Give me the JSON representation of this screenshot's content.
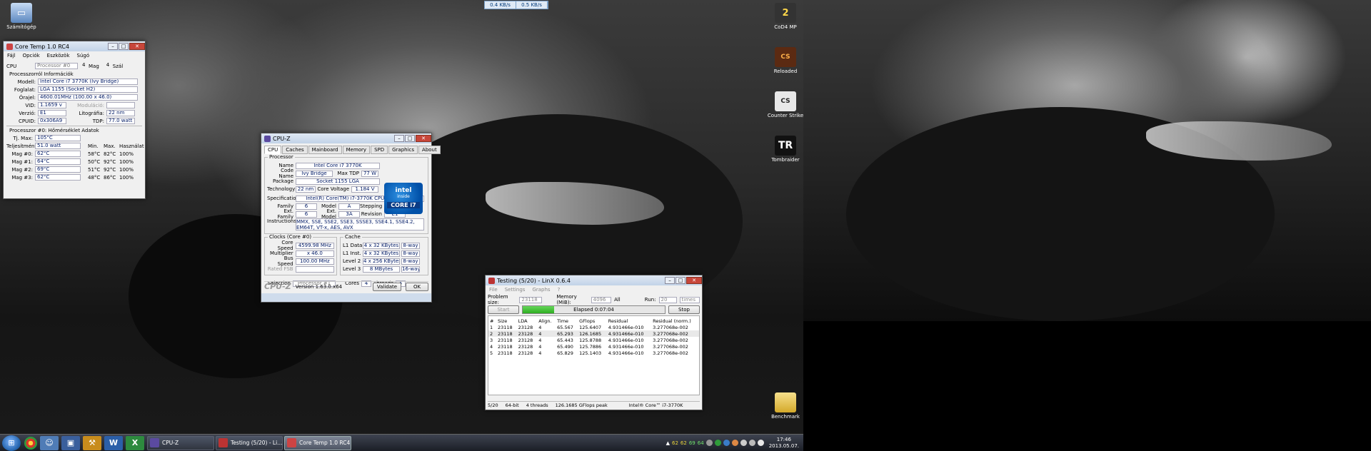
{
  "desktop": {
    "icons_left": [
      {
        "label": "Számítógép"
      }
    ],
    "icons_right": [
      {
        "label": "CoD4 MP",
        "badge": "2"
      },
      {
        "label": "Reloaded",
        "badge": "CS"
      },
      {
        "label": "Counter Strike",
        "badge": "CS"
      },
      {
        "label": "Tombraider",
        "badge": "TR"
      },
      {
        "label": "Benchmark",
        "badge": ""
      }
    ]
  },
  "netmeter": {
    "down": "0.4 KB/s",
    "up": "0.5 KB/s"
  },
  "coretemp": {
    "title": "Core Temp 1.0 RC4",
    "menu": [
      "Fájl",
      "Opciók",
      "Eszközök",
      "Súgó"
    ],
    "cpu_label": "CPU",
    "processor_select": "Processor #0",
    "cores": "4",
    "cores_label": "Mag",
    "threads": "4",
    "threads_label": "Szál",
    "info_section": "Processzorról Információk",
    "model_label": "Modell:",
    "model": "Intel Core i7 3770K (Ivy Bridge)",
    "socket_label": "Foglalat:",
    "socket": "LGA 1155 (Socket H2)",
    "freq_label": "Órajel:",
    "freq": "4600.01MHz (100.00 x 46.0)",
    "vid_label": "VID:",
    "vid": "1.1659 v",
    "modulation_label": "Moduláció:",
    "revision_label": "Verzió:",
    "revision": "E1",
    "litho_label": "Litográfia:",
    "litho": "22 nm",
    "cpuid_label": "CPUID:",
    "cpuid": "0x306A9",
    "tdp_label": "TDP:",
    "tdp": "77.0 watt",
    "temp_section": "Processzor #0: Hőmérséklet Adatok",
    "tjmax_label": "Tj. Max:",
    "tjmax": "105°C",
    "power_label": "Teljesítmény:",
    "power": "51.0 watt",
    "col_min": "Min.",
    "col_max": "Max.",
    "col_load": "Használat",
    "cores_rows": [
      {
        "label": "Mag #0:",
        "temp": "62°C",
        "min": "58°C",
        "max": "82°C",
        "load": "100%"
      },
      {
        "label": "Mag #1:",
        "temp": "64°C",
        "min": "50°C",
        "max": "92°C",
        "load": "100%"
      },
      {
        "label": "Mag #2:",
        "temp": "69°C",
        "min": "51°C",
        "max": "92°C",
        "load": "100%"
      },
      {
        "label": "Mag #3:",
        "temp": "62°C",
        "min": "48°C",
        "max": "86°C",
        "load": "100%"
      }
    ]
  },
  "cpuz": {
    "title": "CPU-Z",
    "tabs": [
      "CPU",
      "Caches",
      "Mainboard",
      "Memory",
      "SPD",
      "Graphics",
      "About"
    ],
    "processor_group": "Processor",
    "name_label": "Name",
    "name": "Intel Core i7 3770K",
    "codename_label": "Code Name",
    "codename": "Ivy Bridge",
    "maxtdp_label": "Max TDP",
    "maxtdp": "77 W",
    "package_label": "Package",
    "package": "Socket 1155 LGA",
    "tech_label": "Technology",
    "tech": "22 nm",
    "corevolt_label": "Core Voltage",
    "corevolt": "1.184 V",
    "spec_label": "Specification",
    "spec": "Intel(R) Core(TM) i7-3770K CPU @ 3.50GHz",
    "family_label": "Family",
    "family": "6",
    "model_label": "Model",
    "model": "A",
    "stepping_label": "Stepping",
    "stepping": "9",
    "extfamily_label": "Ext. Family",
    "extfamily": "6",
    "extmodel_label": "Ext. Model",
    "extmodel": "3A",
    "revision_label": "Revision",
    "revision": "E1",
    "instr_label": "Instructions",
    "instr": "MMX, SSE, SSE2, SSE3, SSSE3, SSE4.1, SSE4.2, EM64T, VT-x, AES, AVX",
    "logo_brand": "intel",
    "logo_line": "inside",
    "logo_model": "CORE i7",
    "clocks_group": "Clocks (Core #0)",
    "corespeed_label": "Core Speed",
    "corespeed": "4599.98 MHz",
    "multiplier_label": "Multiplier",
    "multiplier": "x 46.0",
    "busspeed_label": "Bus Speed",
    "busspeed": "100.00 MHz",
    "ratedfsb_label": "Rated FSB",
    "cache_group": "Cache",
    "caches": [
      {
        "label": "L1 Data",
        "size": "4 x 32 KBytes",
        "way": "8-way"
      },
      {
        "label": "L1 Inst.",
        "size": "4 x 32 KBytes",
        "way": "8-way"
      },
      {
        "label": "Level 2",
        "size": "4 x 256 KBytes",
        "way": "8-way"
      },
      {
        "label": "Level 3",
        "size": "8 MBytes",
        "way": "16-way"
      }
    ],
    "selection_label": "Selection",
    "selection": "Processor #1",
    "cores_label": "Cores",
    "cores": "4",
    "threads_label": "Threads",
    "threads": "4",
    "brand": "CPU-Z",
    "version": "Version 1.63.0.x64",
    "validate_label": "Validate",
    "ok_label": "OK"
  },
  "linx": {
    "title": "Testing (5/20) - LinX 0.6.4",
    "menu": [
      "File",
      "Settings",
      "Graphs",
      "?"
    ],
    "problem_label": "Problem size:",
    "problem": "23118",
    "memory_label": "Memory (MiB):",
    "memory": "4096",
    "all_label": "All",
    "run_label": "Run:",
    "run": "20",
    "times": "times",
    "start_label": "Start",
    "stop_label": "Stop",
    "elapsed": "Elapsed 0:07:04",
    "progress": 0.22,
    "columns": [
      "#",
      "Size",
      "LDA",
      "Align.",
      "Time",
      "GFlops",
      "Residual",
      "Residual (norm.)"
    ],
    "rows": [
      [
        "1",
        "23118",
        "23128",
        "4",
        "65.567",
        "125.6407",
        "4.931466e-010",
        "3.277068e-002"
      ],
      [
        "2",
        "23118",
        "23128",
        "4",
        "65.293",
        "126.1685",
        "4.931466e-010",
        "3.277068e-002"
      ],
      [
        "3",
        "23118",
        "23128",
        "4",
        "65.443",
        "125.8788",
        "4.931466e-010",
        "3.277068e-002"
      ],
      [
        "4",
        "23118",
        "23128",
        "4",
        "65.490",
        "125.7886",
        "4.931466e-010",
        "3.277068e-002"
      ],
      [
        "5",
        "23118",
        "23128",
        "4",
        "65.829",
        "125.1403",
        "4.931466e-010",
        "3.277068e-002"
      ]
    ],
    "status": [
      "5/20",
      "64-bit",
      "4 threads",
      "126.1685 GFlops peak",
      "Intel® Core™ i7-3770K"
    ]
  },
  "taskbar": {
    "tasks": [
      {
        "label": "CPU-Z"
      },
      {
        "label": "Testing (5/20) - Li..."
      },
      {
        "label": "Core Temp 1.0 RC4"
      }
    ],
    "tray_temps": [
      "62",
      "62",
      "69",
      "64"
    ],
    "time": "17:46",
    "date": "2013.05.07."
  }
}
